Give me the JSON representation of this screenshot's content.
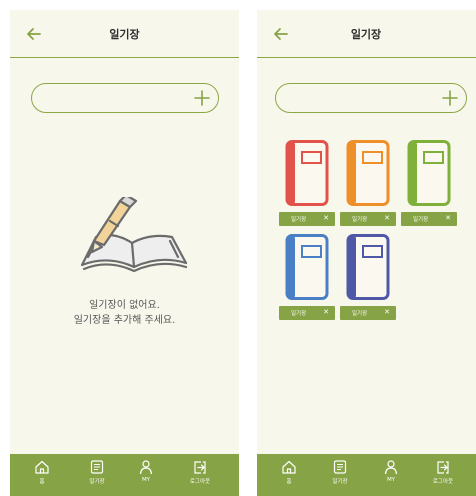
{
  "empty_screen": {
    "header": {
      "title": "일기장"
    },
    "search": {
      "value": "",
      "placeholder": ""
    },
    "empty_message": {
      "line1": "일기장이 없어요.",
      "line2": "일기장을 추가해 주세요."
    },
    "tab_bar": [
      {
        "label": "홈",
        "icon": "home-icon"
      },
      {
        "label": "일기장",
        "icon": "diary-list-icon"
      },
      {
        "label": "MY",
        "icon": "person-icon"
      },
      {
        "label": "로그아웃",
        "icon": "logout-icon"
      }
    ]
  },
  "list_screen": {
    "header": {
      "title": "일기장"
    },
    "search": {
      "value": "",
      "placeholder": ""
    },
    "diaries": [
      {
        "label": "일기장",
        "color": "#e0524a"
      },
      {
        "label": "일기장",
        "color": "#ee8f2a"
      },
      {
        "label": "일기장",
        "color": "#7fb03a"
      },
      {
        "label": "일기장",
        "color": "#4a7fc6"
      },
      {
        "label": "일기장",
        "color": "#4e58a6"
      }
    ],
    "tab_bar": [
      {
        "label": "홈",
        "icon": "home-icon"
      },
      {
        "label": "일기장",
        "icon": "diary-list-icon"
      },
      {
        "label": "MY",
        "icon": "person-icon"
      },
      {
        "label": "로그아웃",
        "icon": "logout-icon"
      }
    ]
  },
  "colors": {
    "accent": "#86a345",
    "background": "#f8f7ec"
  }
}
